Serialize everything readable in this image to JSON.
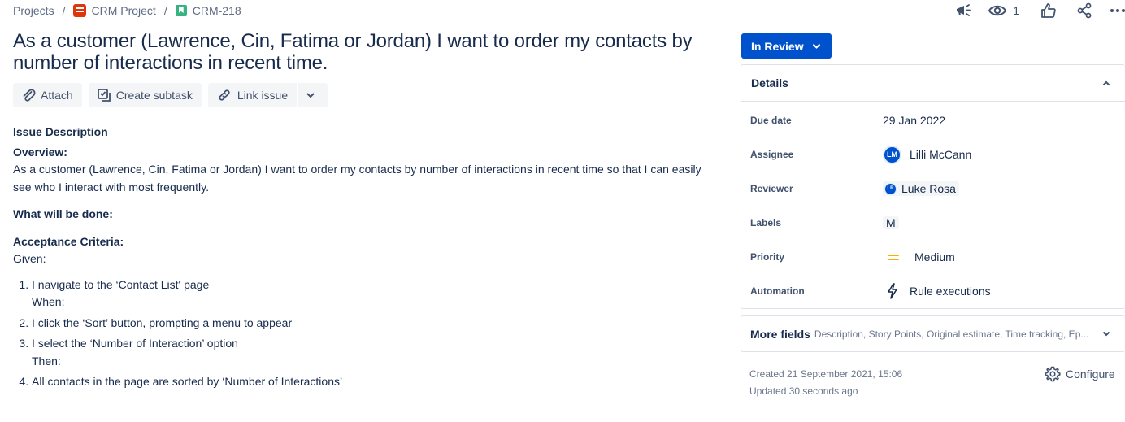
{
  "breadcrumb": {
    "projects": "Projects",
    "sep1": "/",
    "project": "CRM Project",
    "sep2": "/",
    "issue_key": "CRM-218"
  },
  "top_actions": {
    "watchers_count": "1",
    "icons": [
      "megaphone-icon",
      "eye-icon",
      "thumbs-up-icon",
      "share-icon",
      "more-icon"
    ]
  },
  "issue": {
    "title": "As a customer (Lawrence, Cin, Fatima or Jordan) I want to order my contacts by number of interactions in recent time."
  },
  "actions": {
    "attach": "Attach",
    "create_subtask": "Create subtask",
    "link_issue": "Link issue"
  },
  "description": {
    "heading": "Issue Description",
    "overview_heading": "Overview:",
    "overview_text": "As a customer (Lawrence, Cin, Fatima or Jordan) I want to order my contacts by number of interactions in recent time so that I can easily see who I interact with most frequently.",
    "done_heading": "What will be done:",
    "criteria_heading": "Acceptance Criteria:",
    "given": "Given:",
    "steps": [
      {
        "text": "I navigate to the ‘Contact List' page",
        "after": "When:"
      },
      {
        "text": "I click the ‘Sort’ button, prompting a menu to appear",
        "after": ""
      },
      {
        "text": "I select the ‘Number of Interaction’ option",
        "after": "Then:"
      },
      {
        "text": "All contacts in the page are sorted by ‘Number of Interactions’",
        "after": ""
      }
    ]
  },
  "status": {
    "label": "In Review"
  },
  "details": {
    "heading": "Details",
    "due_date": {
      "label": "Due date",
      "value": "29 Jan 2022"
    },
    "assignee": {
      "label": "Assignee",
      "initials": "LM",
      "value": "Lilli McCann"
    },
    "reviewer": {
      "label": "Reviewer",
      "initials": "LR",
      "value": "Luke Rosa"
    },
    "labels": {
      "label": "Labels",
      "value": "M"
    },
    "priority": {
      "label": "Priority",
      "value": "Medium"
    },
    "automation": {
      "label": "Automation",
      "value": "Rule executions"
    }
  },
  "more_fields": {
    "title": "More fields",
    "subtitle": "Description, Story Points, Original estimate, Time tracking, Ep..."
  },
  "meta": {
    "created": "Created 21 September 2021, 15:06",
    "updated": "Updated 30 seconds ago"
  },
  "configure": "Configure",
  "colors": {
    "primary": "#0052CC",
    "text": "#172B4D",
    "subtle": "#42526E",
    "priority_medium": "#FFAB00",
    "story": "#36B37E",
    "project": "#DE350B"
  }
}
